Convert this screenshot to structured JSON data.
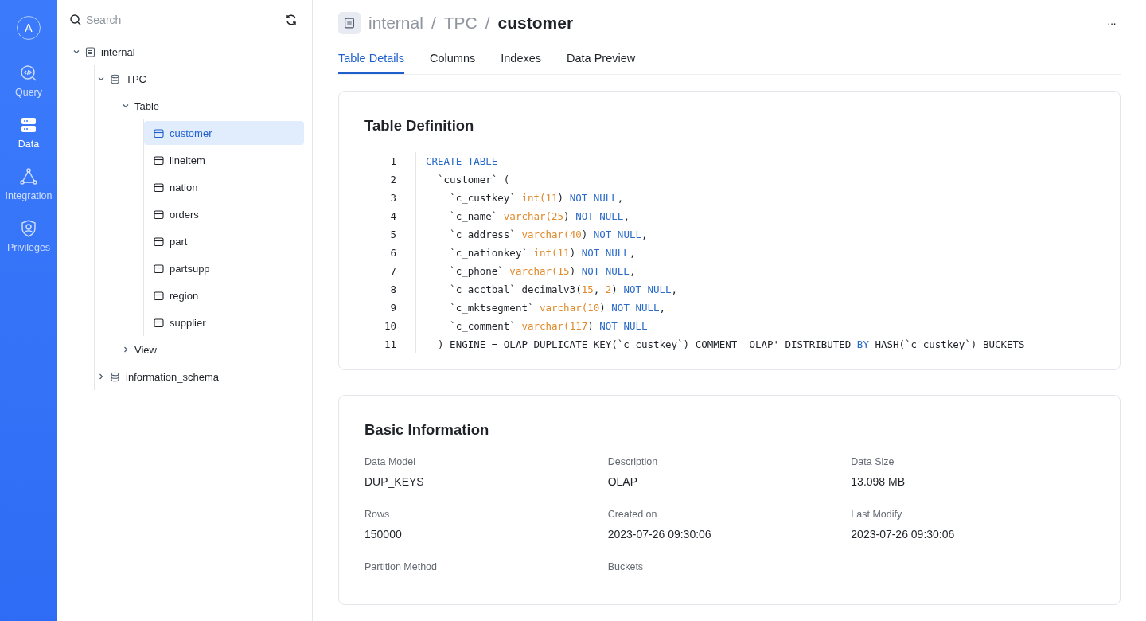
{
  "nav": {
    "avatar": "A",
    "items": [
      {
        "label": "Query",
        "kind": "query",
        "selected": false
      },
      {
        "label": "Data",
        "kind": "data",
        "selected": true
      },
      {
        "label": "Integration",
        "kind": "integration",
        "selected": false
      },
      {
        "label": "Privileges",
        "kind": "privileges",
        "selected": false
      }
    ]
  },
  "tree_panel": {
    "search": {
      "placeholder": "Search"
    },
    "tree": [
      {
        "label": "internal",
        "kind": "catalog",
        "expanded": true,
        "selected": false,
        "children": [
          {
            "label": "TPC",
            "kind": "database",
            "expanded": true,
            "selected": false,
            "children": [
              {
                "label": "Table",
                "expanded": true,
                "selected": false,
                "children": [
                  {
                    "label": "customer",
                    "kind": "table",
                    "selected": true
                  },
                  {
                    "label": "lineitem",
                    "kind": "table",
                    "selected": false
                  },
                  {
                    "label": "nation",
                    "kind": "table",
                    "selected": false
                  },
                  {
                    "label": "orders",
                    "kind": "table",
                    "selected": false
                  },
                  {
                    "label": "part",
                    "kind": "table",
                    "selected": false
                  },
                  {
                    "label": "partsupp",
                    "kind": "table",
                    "selected": false
                  },
                  {
                    "label": "region",
                    "kind": "table",
                    "selected": false
                  },
                  {
                    "label": "supplier",
                    "kind": "table",
                    "selected": false
                  }
                ]
              },
              {
                "label": "View",
                "expanded": false,
                "selected": false
              }
            ]
          },
          {
            "label": "information_schema",
            "kind": "database",
            "expanded": false,
            "selected": false
          }
        ]
      }
    ]
  },
  "header": {
    "breadcrumb": [
      "internal",
      "TPC",
      "customer"
    ],
    "separator": "/",
    "more": "···"
  },
  "tabs": [
    {
      "label": "Table Details",
      "selected": true
    },
    {
      "label": "Columns",
      "selected": false
    },
    {
      "label": "Indexes",
      "selected": false
    },
    {
      "label": "Data Preview",
      "selected": false
    }
  ],
  "table_definition": {
    "title": "Table Definition",
    "lines": [
      {
        "number": "1",
        "tokens": [
          {
            "text": "CREATE TABLE",
            "kind": "keyword"
          }
        ]
      },
      {
        "number": "2",
        "tokens": [
          {
            "text": "  `customer` (",
            "kind": "plain"
          }
        ]
      },
      {
        "number": "3",
        "tokens": [
          {
            "text": "    `c_custkey` ",
            "kind": "plain"
          },
          {
            "text": "int(11",
            "kind": "type"
          },
          {
            "text": ") ",
            "kind": "plain"
          },
          {
            "text": "NOT NULL",
            "kind": "keyword"
          },
          {
            "text": ",",
            "kind": "plain"
          }
        ]
      },
      {
        "number": "4",
        "tokens": [
          {
            "text": "    `c_name` ",
            "kind": "plain"
          },
          {
            "text": "varchar(25",
            "kind": "type"
          },
          {
            "text": ") ",
            "kind": "plain"
          },
          {
            "text": "NOT NULL",
            "kind": "keyword"
          },
          {
            "text": ",",
            "kind": "plain"
          }
        ]
      },
      {
        "number": "5",
        "tokens": [
          {
            "text": "    `c_address` ",
            "kind": "plain"
          },
          {
            "text": "varchar(40",
            "kind": "type"
          },
          {
            "text": ") ",
            "kind": "plain"
          },
          {
            "text": "NOT NULL",
            "kind": "keyword"
          },
          {
            "text": ",",
            "kind": "plain"
          }
        ]
      },
      {
        "number": "6",
        "tokens": [
          {
            "text": "    `c_nationkey` ",
            "kind": "plain"
          },
          {
            "text": "int(11",
            "kind": "type"
          },
          {
            "text": ") ",
            "kind": "plain"
          },
          {
            "text": "NOT NULL",
            "kind": "keyword"
          },
          {
            "text": ",",
            "kind": "plain"
          }
        ]
      },
      {
        "number": "7",
        "tokens": [
          {
            "text": "    `c_phone` ",
            "kind": "plain"
          },
          {
            "text": "varchar(15",
            "kind": "type"
          },
          {
            "text": ") ",
            "kind": "plain"
          },
          {
            "text": "NOT NULL",
            "kind": "keyword"
          },
          {
            "text": ",",
            "kind": "plain"
          }
        ]
      },
      {
        "number": "8",
        "tokens": [
          {
            "text": "    `c_acctbal` decimalv3(",
            "kind": "plain"
          },
          {
            "text": "15",
            "kind": "type"
          },
          {
            "text": ", ",
            "kind": "plain"
          },
          {
            "text": "2",
            "kind": "type"
          },
          {
            "text": ") ",
            "kind": "plain"
          },
          {
            "text": "NOT NULL",
            "kind": "keyword"
          },
          {
            "text": ",",
            "kind": "plain"
          }
        ]
      },
      {
        "number": "9",
        "tokens": [
          {
            "text": "    `c_mktsegment` ",
            "kind": "plain"
          },
          {
            "text": "varchar(10",
            "kind": "type"
          },
          {
            "text": ") ",
            "kind": "plain"
          },
          {
            "text": "NOT NULL",
            "kind": "keyword"
          },
          {
            "text": ",",
            "kind": "plain"
          }
        ]
      },
      {
        "number": "10",
        "tokens": [
          {
            "text": "    `c_comment` ",
            "kind": "plain"
          },
          {
            "text": "varchar(117",
            "kind": "type"
          },
          {
            "text": ") ",
            "kind": "plain"
          },
          {
            "text": "NOT NULL",
            "kind": "keyword"
          }
        ]
      },
      {
        "number": "11",
        "tokens": [
          {
            "text": "  ) ENGINE = OLAP DUPLICATE KEY(`c_custkey`) COMMENT 'OLAP' DISTRIBUTED ",
            "kind": "plain"
          },
          {
            "text": "BY",
            "kind": "keyword"
          },
          {
            "text": " HASH(`c_custkey`) BUCKETS",
            "kind": "plain"
          }
        ]
      }
    ]
  },
  "basic_information": {
    "title": "Basic Information",
    "fields": [
      {
        "label": "Data Model",
        "value": "DUP_KEYS"
      },
      {
        "label": "Description",
        "value": "OLAP"
      },
      {
        "label": "Data Size",
        "value": "13.098 MB"
      },
      {
        "label": "Rows",
        "value": "150000"
      },
      {
        "label": "Created on",
        "value": "2023-07-26 09:30:06"
      },
      {
        "label": "Last Modify",
        "value": "2023-07-26 09:30:06"
      },
      {
        "label": "Partition Method"
      },
      {
        "label": "Buckets"
      }
    ]
  }
}
